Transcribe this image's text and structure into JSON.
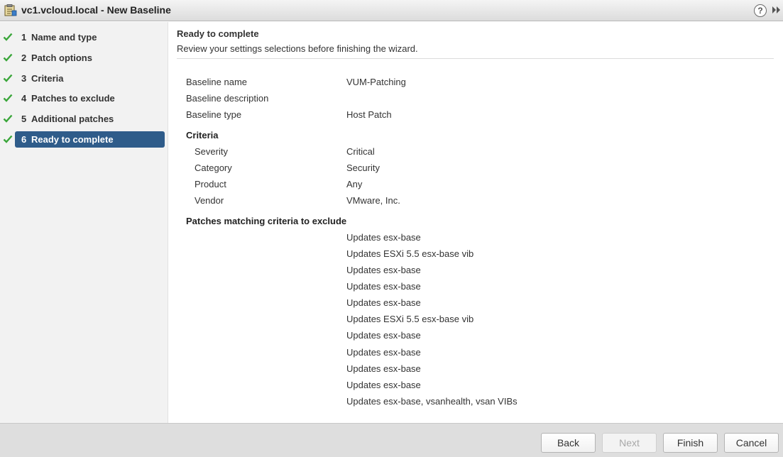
{
  "window": {
    "title": "vc1.vcloud.local - New Baseline",
    "help_glyph": "?",
    "icons": {
      "app": "baseline-wizard-icon",
      "help": "help-icon",
      "expand": "double-chevron-right-icon"
    }
  },
  "steps": [
    {
      "num": "1",
      "label": "Name and type",
      "complete": true
    },
    {
      "num": "2",
      "label": "Patch options",
      "complete": true
    },
    {
      "num": "3",
      "label": "Criteria",
      "complete": true
    },
    {
      "num": "4",
      "label": "Patches to exclude",
      "complete": true
    },
    {
      "num": "5",
      "label": "Additional patches",
      "complete": true
    },
    {
      "num": "6",
      "label": "Ready to complete",
      "complete": true,
      "active": true
    }
  ],
  "colors": {
    "accent": "#2f5c8a",
    "check": "#3aa63a"
  },
  "page": {
    "title": "Ready to complete",
    "subtitle": "Review your settings selections before finishing the wizard."
  },
  "summary": {
    "baseline_name": {
      "label": "Baseline name",
      "value": "VUM-Patching"
    },
    "baseline_description": {
      "label": "Baseline description",
      "value": ""
    },
    "baseline_type": {
      "label": "Baseline type",
      "value": "Host Patch"
    }
  },
  "criteria": {
    "heading": "Criteria",
    "items": [
      {
        "label": "Severity",
        "value": "Critical"
      },
      {
        "label": "Category",
        "value": "Security"
      },
      {
        "label": "Product",
        "value": "Any"
      },
      {
        "label": "Vendor",
        "value": "VMware, Inc."
      }
    ]
  },
  "exclude": {
    "heading": "Patches matching criteria to exclude",
    "items": [
      "Updates esx-base",
      "Updates ESXi 5.5 esx-base vib",
      "Updates esx-base",
      "Updates esx-base",
      "Updates esx-base",
      "Updates ESXi 5.5 esx-base vib",
      "Updates esx-base",
      "Updates esx-base",
      "Updates esx-base",
      "Updates esx-base",
      "Updates esx-base, vsanhealth, vsan VIBs"
    ]
  },
  "footer": {
    "back": "Back",
    "next": "Next",
    "finish": "Finish",
    "cancel": "Cancel"
  }
}
